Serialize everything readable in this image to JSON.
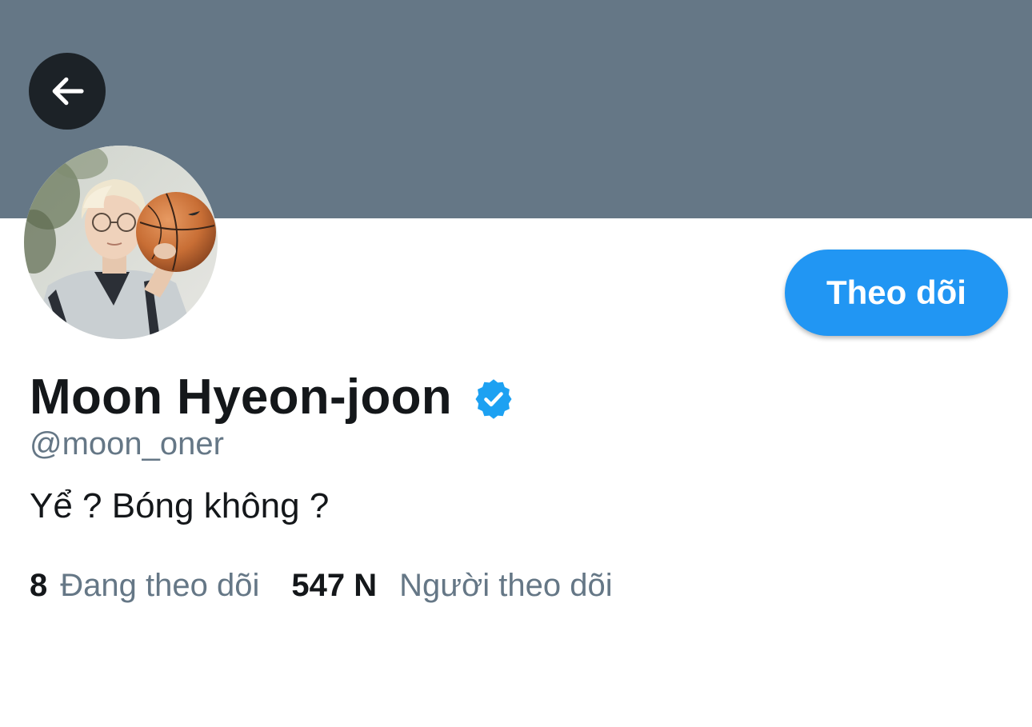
{
  "profile": {
    "display_name": "Moon Hyeon-joon",
    "handle": "@moon_oner",
    "bio": "Yể ? Bóng không ?",
    "verified": true
  },
  "actions": {
    "follow_label": "Theo dõi"
  },
  "stats": {
    "following_count": "8",
    "following_label": "Đang theo dõi",
    "followers_count": "547 N",
    "followers_label": "Người theo dõi"
  },
  "icons": {
    "back": "arrow-left-icon",
    "verified": "verified-badge-icon"
  },
  "colors": {
    "banner": "#657786",
    "accent": "#2196f3",
    "back_button_bg": "#1c2227",
    "text_primary": "#14171a",
    "text_secondary": "#657786"
  }
}
